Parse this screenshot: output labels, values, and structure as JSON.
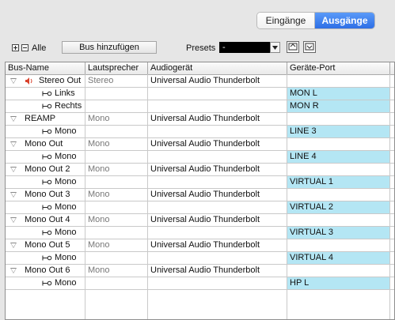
{
  "tabs": {
    "inputs": "Eingänge",
    "outputs": "Ausgänge"
  },
  "toolbar": {
    "alle": "Alle",
    "add_bus": "Bus hinzufügen",
    "presets_label": "Presets",
    "presets_value": "-"
  },
  "columns": [
    "Bus-Name",
    "Lautsprecher",
    "Audiogerät",
    "Geräte-Port"
  ],
  "rows": [
    {
      "type": "bus",
      "name": "Stereo Out",
      "speaker": "Stereo",
      "device": "Universal Audio Thunderbolt",
      "port": ""
    },
    {
      "type": "channel",
      "name": "Links",
      "speaker": "",
      "device": "",
      "port": "MON L"
    },
    {
      "type": "channel",
      "name": "Rechts",
      "speaker": "",
      "device": "",
      "port": "MON R"
    },
    {
      "type": "bus",
      "name": "REAMP",
      "speaker": "Mono",
      "device": "Universal Audio Thunderbolt",
      "port": ""
    },
    {
      "type": "channel",
      "name": "Mono",
      "speaker": "",
      "device": "",
      "port": "LINE 3"
    },
    {
      "type": "bus",
      "name": "Mono Out",
      "speaker": "Mono",
      "device": "Universal Audio Thunderbolt",
      "port": ""
    },
    {
      "type": "channel",
      "name": "Mono",
      "speaker": "",
      "device": "",
      "port": "LINE 4"
    },
    {
      "type": "bus",
      "name": "Mono Out 2",
      "speaker": "Mono",
      "device": "Universal Audio Thunderbolt",
      "port": ""
    },
    {
      "type": "channel",
      "name": "Mono",
      "speaker": "",
      "device": "",
      "port": "VIRTUAL 1"
    },
    {
      "type": "bus",
      "name": "Mono Out 3",
      "speaker": "Mono",
      "device": "Universal Audio Thunderbolt",
      "port": ""
    },
    {
      "type": "channel",
      "name": "Mono",
      "speaker": "",
      "device": "",
      "port": "VIRTUAL 2"
    },
    {
      "type": "bus",
      "name": "Mono Out 4",
      "speaker": "Mono",
      "device": "Universal Audio Thunderbolt",
      "port": ""
    },
    {
      "type": "channel",
      "name": "Mono",
      "speaker": "",
      "device": "",
      "port": "VIRTUAL 3"
    },
    {
      "type": "bus",
      "name": "Mono Out 5",
      "speaker": "Mono",
      "device": "Universal Audio Thunderbolt",
      "port": ""
    },
    {
      "type": "channel",
      "name": "Mono",
      "speaker": "",
      "device": "",
      "port": "VIRTUAL 4"
    },
    {
      "type": "bus",
      "name": "Mono Out 6",
      "speaker": "Mono",
      "device": "Universal Audio Thunderbolt",
      "port": ""
    },
    {
      "type": "channel",
      "name": "Mono",
      "speaker": "",
      "device": "",
      "port": "HP L"
    }
  ],
  "colors": {
    "port_highlight": "#b4e6f4",
    "selected_tab": "#2e6fe6",
    "speaker_icon": "#d9412b"
  }
}
